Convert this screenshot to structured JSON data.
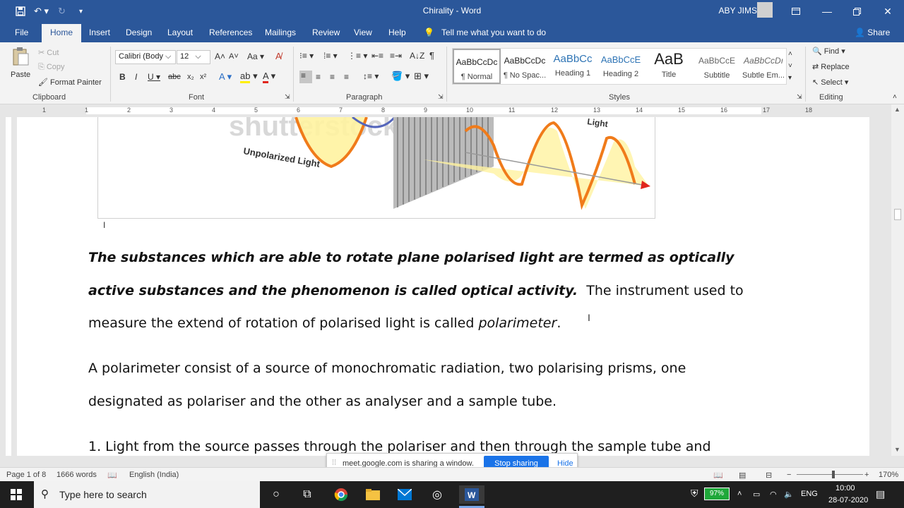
{
  "window": {
    "title": "Chirality - Word",
    "user": "ABY JIMSON"
  },
  "tabs": [
    "File",
    "Home",
    "Insert",
    "Design",
    "Layout",
    "References",
    "Mailings",
    "Review",
    "View",
    "Help"
  ],
  "tell_me": "Tell me what you want to do",
  "share_label": "Share",
  "clipboard": {
    "paste": "Paste",
    "cut": "Cut",
    "copy": "Copy",
    "format_painter": "Format Painter",
    "group": "Clipboard"
  },
  "font": {
    "name": "Calibri (Body",
    "size": "12",
    "group": "Font"
  },
  "paragraph_group": "Paragraph",
  "styles": {
    "items": [
      {
        "preview": "AaBbCcDc",
        "name": "¶ Normal"
      },
      {
        "preview": "AaBbCcDc",
        "name": "¶ No Spac..."
      },
      {
        "preview": "AaBbCc",
        "name": "Heading 1"
      },
      {
        "preview": "AaBbCcE",
        "name": "Heading 2"
      },
      {
        "preview": "AaB",
        "name": "Title"
      },
      {
        "preview": "AaBbCcE",
        "name": "Subtitle"
      },
      {
        "preview": "AaBbCcDı",
        "name": "Subtle Em..."
      }
    ],
    "group": "Styles"
  },
  "editing": {
    "find": "Find",
    "replace": "Replace",
    "select": "Select",
    "group": "Editing"
  },
  "ruler_numbers": [
    "1",
    "1",
    "2",
    "3",
    "4",
    "5",
    "6",
    "7",
    "8",
    "9",
    "10",
    "11",
    "12",
    "13",
    "14",
    "15",
    "16",
    "17",
    "18"
  ],
  "figure": {
    "watermark": "shutterstock",
    "label_unpolarized": "Unpolarized Light",
    "label_light": "Light"
  },
  "document": {
    "para1_line1_bold": "The substances which are able to rotate plane polarised light are termed as optically",
    "para1_line2_bold": "active substances and the phenomenon is called optical activity.",
    "para1_line2_rest": "The instrument used to",
    "para1_line3_a": "measure the extend of rotation of polarised light is called ",
    "para1_line3_italic": "polarimeter",
    "para1_line3_end": ".",
    "para2_line1": "A polarimeter consist of a source of monochromatic radiation, two polarising prisms, one",
    "para2_line2": "designated as polariser and the other as analyser and a sample tube.",
    "para3_line1": "1. Light from the source passes through the polariser and then through the sample tube and"
  },
  "share_bar": {
    "message": "meet.google.com is sharing a window.",
    "stop": "Stop sharing",
    "hide": "Hide"
  },
  "status": {
    "page": "Page 1 of 8",
    "words": "1666 words",
    "language": "English (India)",
    "zoom": "170%"
  },
  "taskbar": {
    "search_placeholder": "Type here to search",
    "battery": "97%",
    "lang": "ENG",
    "time": "10:00",
    "date": "28-07-2020"
  },
  "colors": {
    "word_blue": "#2b579a",
    "wave_orange": "#f07b1a",
    "wave_fill": "#fff09a",
    "arrow_red": "#e0261c",
    "stop_blue": "#1a73e8",
    "battery_green": "#1fa83a"
  }
}
